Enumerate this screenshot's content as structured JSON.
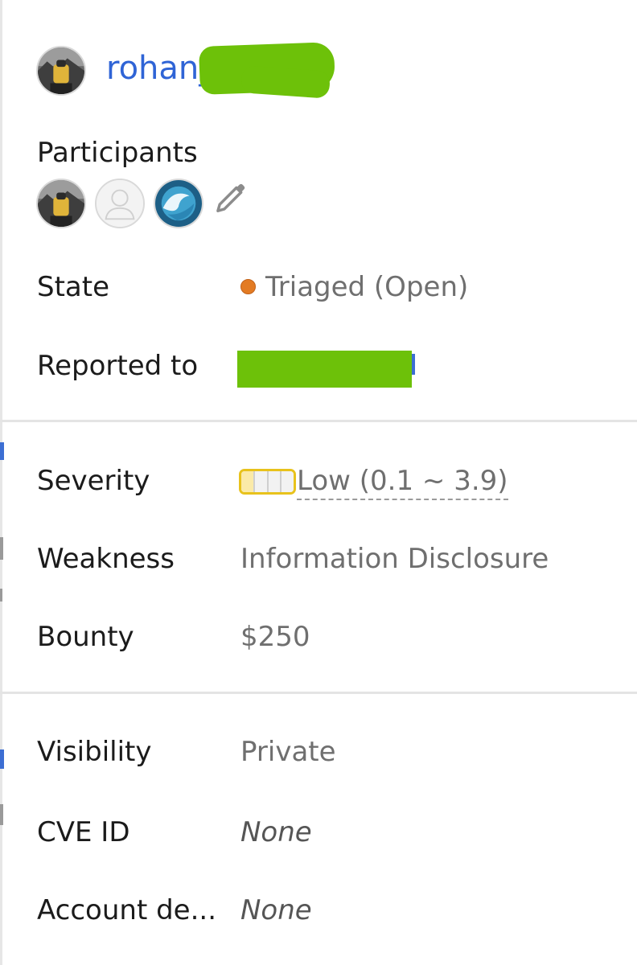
{
  "author": {
    "name": "rohan_",
    "avatar": "hiker-avatar"
  },
  "participants": {
    "title": "Participants",
    "avatars": [
      "hiker-avatar",
      "default-user-avatar",
      "wave-avatar"
    ],
    "edit_icon": "pencil-icon"
  },
  "fields": {
    "state": {
      "label": "State",
      "value": "Triaged (Open)",
      "dot_color": "#e37b23"
    },
    "reported_to": {
      "label": "Reported to",
      "value": ""
    },
    "severity": {
      "label": "Severity",
      "value": "Low (0.1 ~ 3.9)",
      "level_segments_filled": 1,
      "level_segments_total": 4,
      "meter_color": "#e8c21c"
    },
    "weakness": {
      "label": "Weakness",
      "value": "Information Disclosure"
    },
    "bounty": {
      "label": "Bounty",
      "value": "$250"
    },
    "visibility": {
      "label": "Visibility",
      "value": "Private"
    },
    "cve_id": {
      "label": "CVE ID",
      "value": "None"
    },
    "account_details": {
      "label": "Account de...",
      "value": "None"
    }
  },
  "colors": {
    "link": "#2f64d6",
    "redaction": "#6dc109",
    "divider": "#e4e4e4"
  }
}
